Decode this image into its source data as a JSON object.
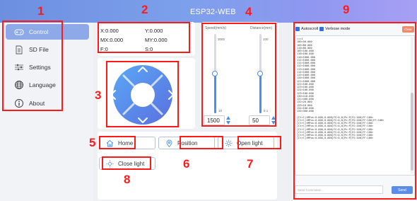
{
  "app": {
    "title": "ESP32-WEB"
  },
  "sidebar": {
    "items": [
      {
        "label": "Control",
        "icon": "gamepad-icon",
        "active": true
      },
      {
        "label": "SD File",
        "icon": "file-icon",
        "active": false
      },
      {
        "label": "Settings",
        "icon": "settings-icon",
        "active": false
      },
      {
        "label": "Language",
        "icon": "globe-icon",
        "active": false
      },
      {
        "label": "About",
        "icon": "info-icon",
        "active": false
      }
    ]
  },
  "position": {
    "x": "X:0.000",
    "y": "Y:0.000",
    "mx": "MX:0.000",
    "my": "MY:0.000",
    "f": "F:0",
    "s": "S:0"
  },
  "sliders": {
    "speed": {
      "label": "Speed(mm/s)",
      "max_label": "3000",
      "min_label": "10",
      "value": "1500",
      "fraction": 0.5
    },
    "distance": {
      "label": "Distance(mm)",
      "max_label": "100",
      "min_label": "0.1",
      "value": "50",
      "fraction": 0.5
    }
  },
  "buttons": {
    "home": "Home",
    "position": "Position",
    "open_light": "Open light",
    "close_light": "Close light"
  },
  "log": {
    "autoscroll_label": "Autoscroll",
    "verbose_label": "Verbose mode",
    "clear_label": "Clear",
    "lines": "==>1\n100<50.000\n105<80.000\n110<80.000\n105<100.000\n110<100.000\n110<1000.000\n111<1000.000\n111<1000.000\n112<1000.000\n113<1000.000\n114<1000.000\n115<1000.000\n120<1000.000\n121<1000.000\n122<100.000\n123<100.000\n124<100.000\n125<100.000\n130<410.000\n131<400.000\n132<20.000\n133<10.000\n134<100.000\n135<300.000\n\n[Ctrl]<MPos:0.000,0.000|FS:0,0|Pn:P|FS:100|FF:100>\n[Ctrl]<MPos:0.000,0.000|FS:0,0|Pn:P|FS:100|FF:100|FF:100>\n[Ctrl]<MPos:0.000,0.000|FS:0,0|Pn:P|FS:100|FF:100>\n[Ctrl]<MPos:0.000,0.000|FS:0,0|Pn:P|FS:100|FF:100>\n[Ctrl]<MPos:0.000,0.000|FS:0,0|Pn:P|FS:100|FF:100>\n[Ctrl]<MPos:0.000,0.000|FS:0,0|Pn:P|FS:100|FF:100>\n[Ctrl]<MPos:0.000,0.000|FS:0,0|Pn:P|FS:100|FF:100>\n[Ctrl]<MPos:0.000,0.000|FS:0,0|Pn:P|FS:100|FF:100>",
    "command_placeholder": "Send Command...",
    "send_label": "Send"
  },
  "annotations": {
    "n1": "1",
    "n2": "2",
    "n3": "3",
    "n4": "4",
    "n5": "5",
    "n6": "6",
    "n7": "7",
    "n8": "8",
    "n9": "9",
    "color": "#ff1a1a"
  },
  "colors": {
    "header_start": "#6d8fe0",
    "header_end": "#a7a0f4",
    "accent": "#4f8ef0",
    "sidebar_active": "#8ea9e8",
    "clear_button": "#f08a6a"
  }
}
